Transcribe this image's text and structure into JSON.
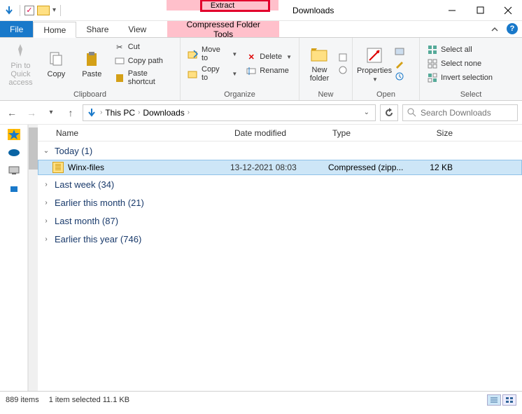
{
  "window": {
    "title": "Downloads"
  },
  "context_tab": {
    "top": "Extract",
    "sub": "Compressed Folder Tools"
  },
  "tabs": {
    "file": "File",
    "home": "Home",
    "share": "Share",
    "view": "View"
  },
  "ribbon": {
    "clipboard": {
      "label": "Clipboard",
      "pin": "Pin to Quick access",
      "copy": "Copy",
      "paste": "Paste",
      "cut": "Cut",
      "copy_path": "Copy path",
      "paste_shortcut": "Paste shortcut"
    },
    "organize": {
      "label": "Organize",
      "move_to": "Move to",
      "copy_to": "Copy to",
      "delete": "Delete",
      "rename": "Rename"
    },
    "new": {
      "label": "New",
      "new_folder": "New folder"
    },
    "open": {
      "label": "Open",
      "properties": "Properties"
    },
    "select": {
      "label": "Select",
      "select_all": "Select all",
      "select_none": "Select none",
      "invert": "Invert selection"
    }
  },
  "breadcrumb": {
    "root": "This PC",
    "folder": "Downloads"
  },
  "search": {
    "placeholder": "Search Downloads"
  },
  "columns": {
    "name": "Name",
    "date": "Date modified",
    "type": "Type",
    "size": "Size"
  },
  "groups": [
    {
      "label": "Today (1)",
      "expanded": true
    },
    {
      "label": "Last week (34)",
      "expanded": false
    },
    {
      "label": "Earlier this month (21)",
      "expanded": false
    },
    {
      "label": "Last month (87)",
      "expanded": false
    },
    {
      "label": "Earlier this year (746)",
      "expanded": false
    }
  ],
  "file": {
    "name": "Winx-files",
    "date": "13-12-2021 08:03",
    "type": "Compressed (zipp...",
    "size": "12 KB"
  },
  "status": {
    "items": "889 items",
    "selected": "1 item selected  11.1 KB"
  }
}
